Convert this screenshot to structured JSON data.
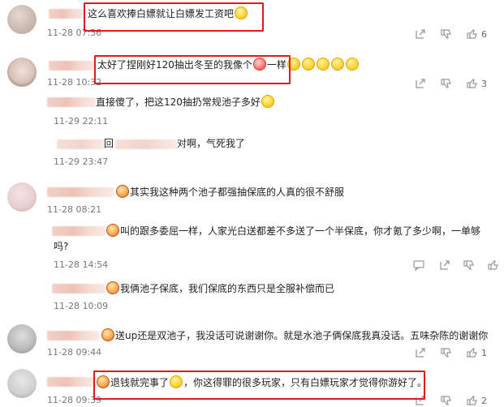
{
  "comments": [
    {
      "text_before": "这么喜欢捧白嫖就让白嫖发工资吧",
      "time": "11-28 07:36",
      "like_count": "6"
    },
    {
      "text_before": "太好了捏刚好120抽出冬至的我像个",
      "text_after": "一样",
      "time": "11-28 10:32",
      "like_count": "3"
    },
    {
      "text": "直接傻了，把这120抽扔常规池子多好",
      "time": "11-29 22:11"
    },
    {
      "text_left": "回",
      "text_right": "对啊，气死我了",
      "time": "11-29 23:47"
    },
    {
      "text": "其实我这种两个池子都强抽保底的人真的很不舒服",
      "time": "11-28 08:21"
    },
    {
      "text_line1": "叫的跟多委屈一样，人家光白送都差不多送了一个半保底，你才氪了多少啊，一单够",
      "text_line2": "吗?",
      "time": "11-28 14:54"
    },
    {
      "text": "我俩池子保底，我们保底的东西只是全服补偿而已",
      "time": "11-28 10:09"
    },
    {
      "text": "送up还是双池子，我没话可说谢谢你。就是水池子俩保底我真没话。五味杂陈的谢谢你",
      "time": "11-28 09:44",
      "like_count": "1"
    },
    {
      "text_before": "退钱就完事了",
      "text_after": "，你这得罪的很多玩家，只有白嫖玩家才觉得你游好了。",
      "time": "11-28 09:39",
      "like_count": "2"
    }
  ],
  "colors": {
    "highlight": "#e01b1b",
    "icon_gray": "#999999",
    "time_gray": "#777777"
  },
  "icons": [
    "share-icon",
    "thumbs-down-icon",
    "thumbs-up-icon",
    "smile-emoji",
    "clown-emoji",
    "crown-emoji",
    "cry-emoji"
  ]
}
